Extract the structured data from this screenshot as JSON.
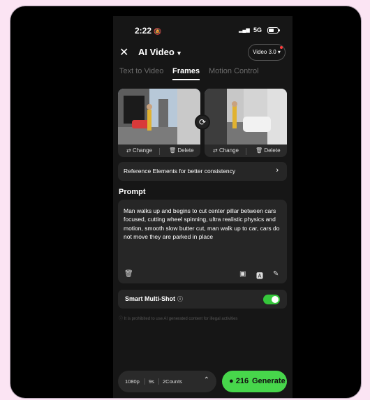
{
  "status": {
    "time": "2:22",
    "network": "5G"
  },
  "header": {
    "title": "AI Video",
    "version": "Video 3.0"
  },
  "tabs": [
    "Text to Video",
    "Frames",
    "Motion Control"
  ],
  "active_tab": "Frames",
  "frames": {
    "change_label": "Change",
    "delete_label": "Delete"
  },
  "reference": {
    "label": "Reference Elements for better consistency"
  },
  "prompt": {
    "label": "Prompt",
    "text": "Man walks up and begins to cut center pillar between cars focused, cutting wheel spinning, ultra realistic physics and motion, smooth slow butter cut, man walk up to car, cars do not move they are parked in place"
  },
  "smart_multishot": {
    "label": "Smart Multi-Shot",
    "enabled": true
  },
  "warning": "It is prohibited to use AI generated content for illegal activities",
  "settings": {
    "resolution": "1080p",
    "duration": "9s",
    "counts": "2Counts"
  },
  "generate": {
    "credits": "216",
    "label": "Generate"
  },
  "colors": {
    "accent": "#47d64b",
    "background": "#161616",
    "card": "#262626"
  }
}
